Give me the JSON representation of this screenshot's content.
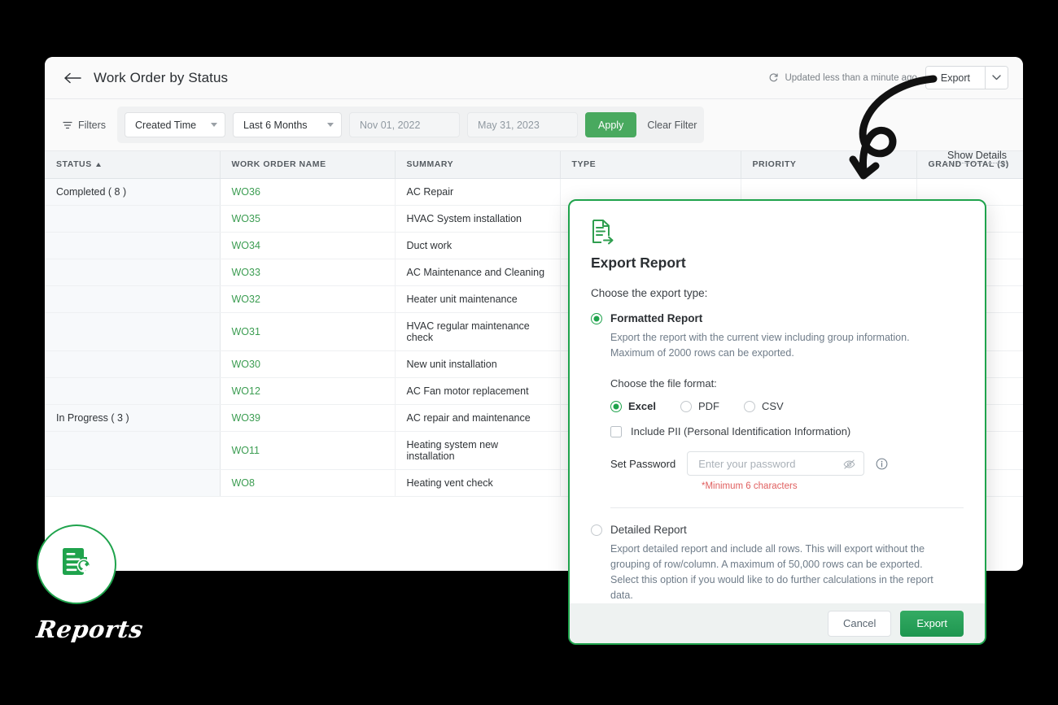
{
  "header": {
    "back_icon": "back-arrow-icon",
    "title": "Work Order by Status",
    "refresh_icon": "refresh-icon",
    "updated_text": "Updated less than a minute ago",
    "export_label": "Export",
    "export_chevron_icon": "chevron-down-icon"
  },
  "filter_bar": {
    "filter_icon": "filter-icon",
    "filters_label": "Filters",
    "field_select": "Created Time",
    "range_select": "Last 6 Months",
    "date_from": "Nov 01, 2022",
    "date_to": "May 31, 2023",
    "apply_label": "Apply",
    "clear_label": "Clear Filter",
    "show_details_label": "Show Details"
  },
  "table": {
    "columns": [
      "STATUS",
      "WORK ORDER NAME",
      "SUMMARY",
      "TYPE",
      "PRIORITY",
      "GRAND TOTAL ($)"
    ],
    "sort_column": "STATUS",
    "sort_direction": "asc",
    "rows": [
      {
        "status": "Completed ( 8 )",
        "name": "WO36",
        "summary": "AC Repair",
        "type": "",
        "priority": "",
        "total": ""
      },
      {
        "status": "",
        "name": "WO35",
        "summary": "HVAC System installation",
        "type": "",
        "priority": "",
        "total": ""
      },
      {
        "status": "",
        "name": "WO34",
        "summary": "Duct work",
        "type": "",
        "priority": "",
        "total": ""
      },
      {
        "status": "",
        "name": "WO33",
        "summary": "AC Maintenance and Cleaning",
        "type": "",
        "priority": "",
        "total": ""
      },
      {
        "status": "",
        "name": "WO32",
        "summary": "Heater unit maintenance",
        "type": "",
        "priority": "",
        "total": ""
      },
      {
        "status": "",
        "name": "WO31",
        "summary": "HVAC regular maintenance check",
        "type": "",
        "priority": "",
        "total": ""
      },
      {
        "status": "",
        "name": "WO30",
        "summary": "New unit installation",
        "type": "",
        "priority": "",
        "total": ""
      },
      {
        "status": "",
        "name": "WO12",
        "summary": "AC Fan motor replacement",
        "type": "",
        "priority": "",
        "total": ""
      },
      {
        "status": "In Progress ( 3 )",
        "name": "WO39",
        "summary": "AC repair and maintenance",
        "type": "",
        "priority": "",
        "total": ""
      },
      {
        "status": "",
        "name": "WO11",
        "summary": "Heating system new installation",
        "type": "",
        "priority": "",
        "total": ""
      },
      {
        "status": "",
        "name": "WO8",
        "summary": "Heating vent check",
        "type": "",
        "priority": "",
        "total": ""
      }
    ]
  },
  "modal": {
    "doc_icon": "document-export-icon",
    "title": "Export Report",
    "export_type_label": "Choose the export type:",
    "formatted": {
      "label": "Formatted Report",
      "selected": true,
      "description": "Export the report with the current view including group information. Maximum of 2000 rows can be exported.",
      "file_format_label": "Choose the file format:",
      "formats": [
        {
          "label": "Excel",
          "selected": true
        },
        {
          "label": "PDF",
          "selected": false
        },
        {
          "label": "CSV",
          "selected": false
        }
      ],
      "pii_label": "Include PII (Personal Identification Information)",
      "pii_checked": false,
      "password_label": "Set Password",
      "password_placeholder": "Enter your password",
      "password_value": "",
      "eye_icon": "eye-slash-icon",
      "info_icon": "info-circle-icon",
      "password_hint": "*Minimum 6 characters"
    },
    "detailed": {
      "label": "Detailed Report",
      "selected": false,
      "description": "Export detailed report and include all rows. This will export without the grouping of row/column. A maximum of 50,000 rows can be exported. Select this option if you would like to do further calculations in the report data."
    },
    "cancel_label": "Cancel",
    "export_label": "Export"
  },
  "badge": {
    "icon": "report-document-wrench-icon",
    "label": "Reports"
  },
  "colors": {
    "brand_green": "#1fa34c",
    "link_green": "#3c9d52",
    "apply_green": "#49a95f",
    "hint_red": "#e06060",
    "header_bg": "#fafafa",
    "table_header_bg": "#f2f4f6",
    "status_col_bg": "#f7f9fb",
    "modal_footer_bg": "#eef2f1",
    "page_bg": "#000000"
  },
  "annotation": {
    "arrow": "curved-loop-arrow"
  }
}
